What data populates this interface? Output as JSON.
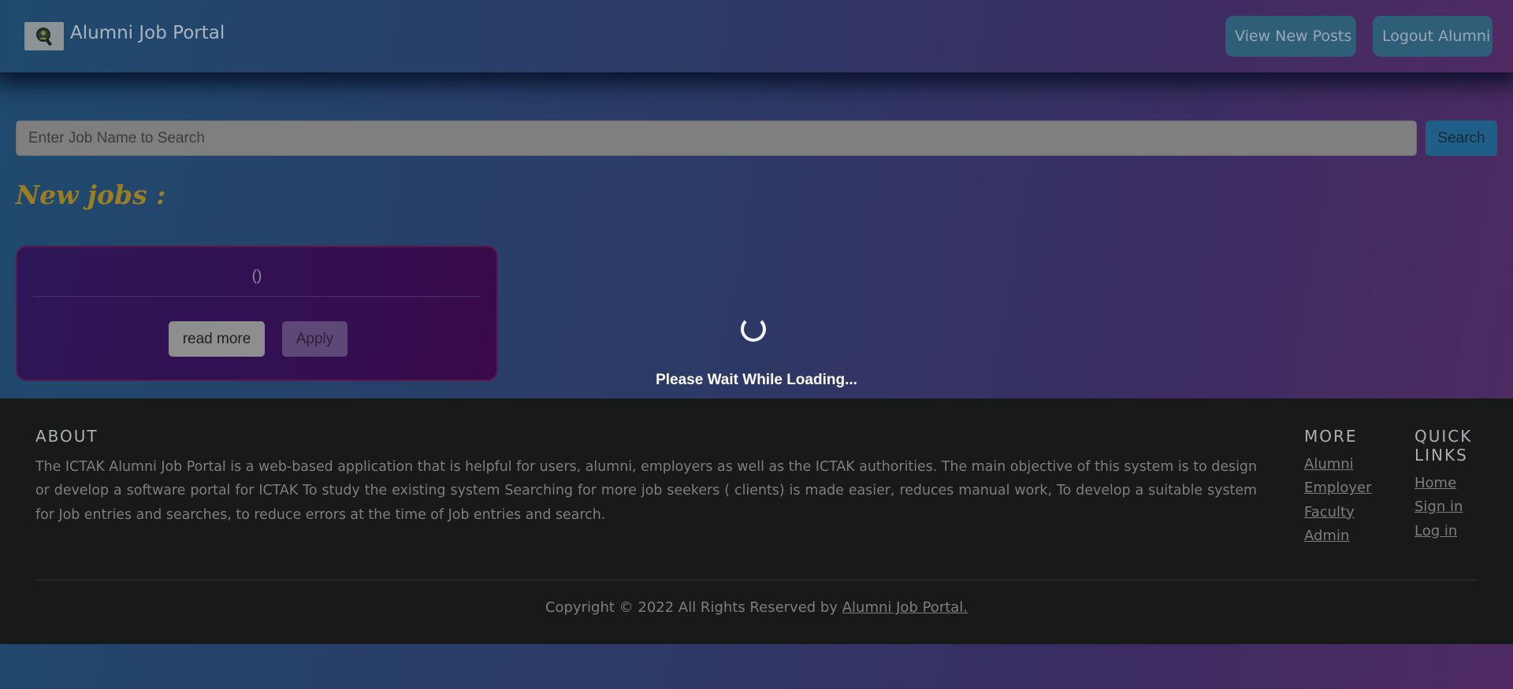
{
  "navbar": {
    "brand_text": "Alumni Job Portal",
    "logo_icon": "search-magnifier-logo-icon",
    "view_posts_label": "View New Posts",
    "logout_label": "Logout Alumni"
  },
  "search": {
    "placeholder": "Enter Job Name to Search",
    "value": "",
    "button_label": "Search"
  },
  "main": {
    "section_title": "New jobs :",
    "job_cards": [
      {
        "title": "()",
        "read_more_label": "read more",
        "apply_label": "Apply"
      }
    ]
  },
  "loading": {
    "text": "Please Wait While Loading..."
  },
  "footer": {
    "about_heading": "ABOUT",
    "about_text": "The ICTAK Alumni Job Portal is a web-based application that is helpful for users, alumni, employers as well as the ICTAK authorities. The main objective of this system is to design or develop a software portal for ICTAK To study the existing system Searching for more job seekers ( clients) is made easier, reduces manual work, To develop a suitable system for Job entries and searches, to reduce errors at the time of Job entries and search.",
    "more_heading": "MORE",
    "more_links": [
      "Alumni",
      "Employer",
      "Faculty",
      "Admin"
    ],
    "quick_heading": "QUICK LINKS",
    "quick_links": [
      "Home",
      "Sign in",
      "Log in"
    ],
    "copyright_prefix": "Copyright © 2022 All Rights Reserved by ",
    "copyright_link": "Alumni Job Portal."
  },
  "colors": {
    "accent_title": "#9b7d22",
    "nav_button": "#2f5e79",
    "search_button": "#1f5e86",
    "footer_bg": "#181a19"
  }
}
